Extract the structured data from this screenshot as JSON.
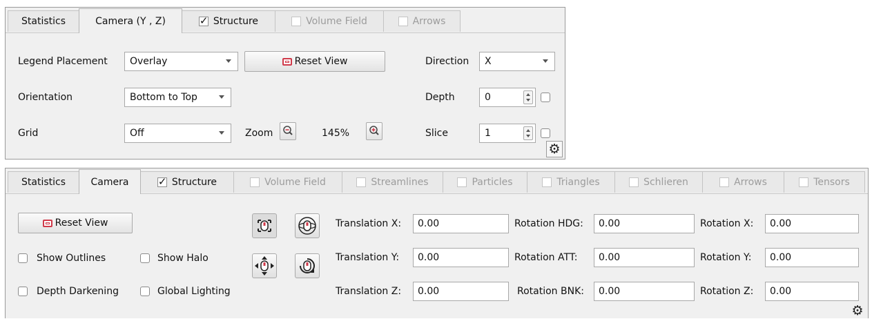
{
  "top_panel": {
    "tabs": [
      {
        "label": "Statistics",
        "checkbox": false,
        "active": false,
        "enabled": true
      },
      {
        "label": "Camera (Y , Z)",
        "checkbox": false,
        "active": true,
        "enabled": true
      },
      {
        "label": "Structure",
        "checkbox": true,
        "checked": true,
        "active": false,
        "enabled": true
      },
      {
        "label": "Volume Field",
        "checkbox": true,
        "checked": false,
        "active": false,
        "enabled": false
      },
      {
        "label": "Arrows",
        "checkbox": true,
        "checked": false,
        "active": false,
        "enabled": false
      }
    ],
    "legend_placement_label": "Legend Placement",
    "legend_placement_value": "Overlay",
    "reset_view_label": "Reset View",
    "orientation_label": "Orientation",
    "orientation_value": "Bottom to Top",
    "grid_label": "Grid",
    "grid_value": "Off",
    "zoom_label": "Zoom",
    "zoom_value": "145%",
    "direction_label": "Direction",
    "direction_value": "X",
    "depth_label": "Depth",
    "depth_value": "0",
    "slice_label": "Slice",
    "slice_value": "1"
  },
  "bottom_panel": {
    "tabs": [
      {
        "label": "Statistics",
        "checkbox": false,
        "active": false,
        "enabled": true
      },
      {
        "label": "Camera",
        "checkbox": false,
        "active": true,
        "enabled": true
      },
      {
        "label": "Structure",
        "checkbox": true,
        "checked": true,
        "active": false,
        "enabled": true
      },
      {
        "label": "Volume Field",
        "checkbox": true,
        "checked": false,
        "active": false,
        "enabled": false
      },
      {
        "label": "Streamlines",
        "checkbox": true,
        "checked": false,
        "active": false,
        "enabled": false
      },
      {
        "label": "Particles",
        "checkbox": true,
        "checked": false,
        "active": false,
        "enabled": false
      },
      {
        "label": "Triangles",
        "checkbox": true,
        "checked": false,
        "active": false,
        "enabled": false
      },
      {
        "label": "Schlieren",
        "checkbox": true,
        "checked": false,
        "active": false,
        "enabled": false
      },
      {
        "label": "Arrows",
        "checkbox": true,
        "checked": false,
        "active": false,
        "enabled": false
      },
      {
        "label": "Tensors",
        "checkbox": true,
        "checked": false,
        "active": false,
        "enabled": false
      }
    ],
    "reset_view_label": "Reset View",
    "show_outlines_label": "Show Outlines",
    "show_halo_label": "Show Halo",
    "depth_darkening_label": "Depth Darkening",
    "global_lighting_label": "Global Lighting",
    "translation_x_label": "Translation X:",
    "translation_x_value": "0.00",
    "translation_y_label": "Translation Y:",
    "translation_y_value": "0.00",
    "translation_z_label": "Translation Z:",
    "translation_z_value": "0.00",
    "rotation_hdg_label": "Rotation HDG:",
    "rotation_hdg_value": "0.00",
    "rotation_att_label": "Rotation ATT:",
    "rotation_att_value": "0.00",
    "rotation_bnk_label": "Rotation BNK:",
    "rotation_bnk_value": "0.00",
    "rotation_x_label": "Rotation X:",
    "rotation_x_value": "0.00",
    "rotation_y_label": "Rotation Y:",
    "rotation_y_value": "0.00",
    "rotation_z_label": "Rotation Z:",
    "rotation_z_value": "0.00"
  },
  "icons": {
    "settings": "gear-icon",
    "zoom_out": "zoom-out-icon",
    "zoom_in": "zoom-in-icon",
    "reset_view": "screen-icon",
    "mouse_pan": "mouse-pan-icon",
    "mouse_orbit": "mouse-orbit-icon",
    "move_arrows": "move-arrows-icon",
    "mouse_rotate": "mouse-rotate-icon"
  },
  "colors": {
    "accent": "#d03a4a",
    "panel_bg": "#f0f0f0",
    "disabled_text": "#9c9c9c"
  }
}
